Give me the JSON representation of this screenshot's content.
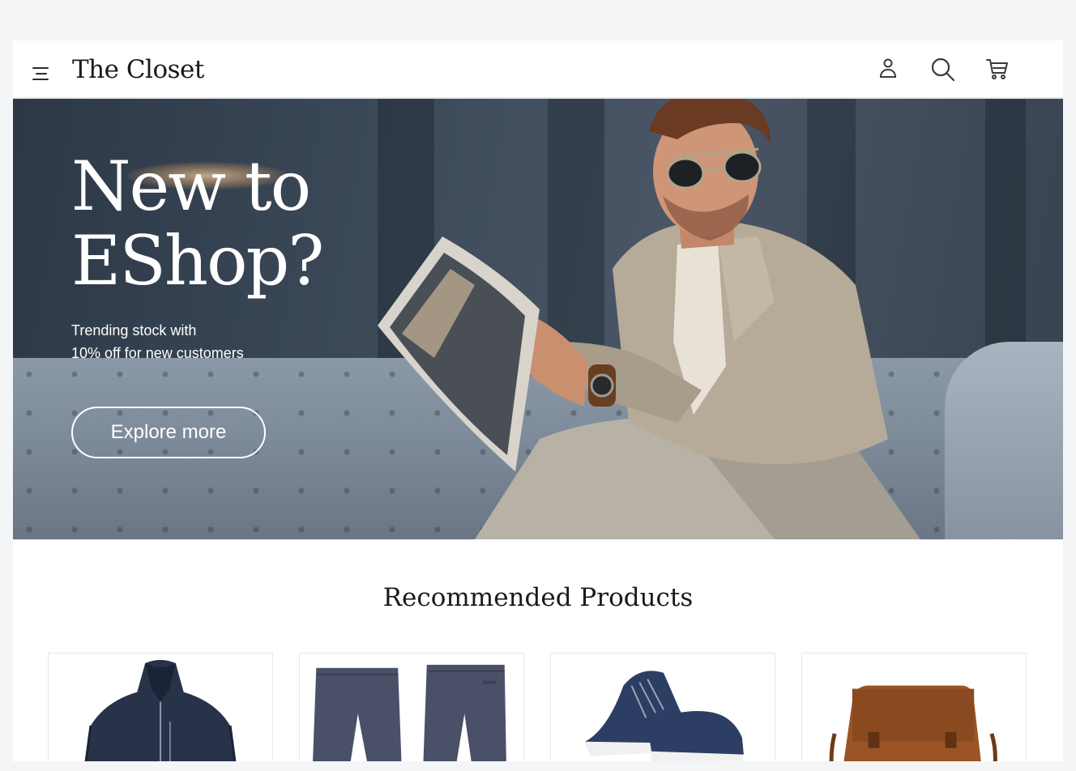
{
  "header": {
    "brand": "The Closet",
    "icons": [
      "menu-icon",
      "user-icon",
      "search-icon",
      "cart-icon"
    ]
  },
  "hero": {
    "title_line1": "New to",
    "title_line2": "EShop?",
    "subtitle_line1": "Trending stock with",
    "subtitle_line2": "10% off for new customers",
    "cta_label": "Explore more"
  },
  "products": {
    "title": "Recommended Products",
    "items": [
      {
        "kind": "jacket",
        "color": "#28334a"
      },
      {
        "kind": "trousers",
        "color": "#4a5068"
      },
      {
        "kind": "sneakers",
        "color": "#2c3e63"
      },
      {
        "kind": "bag",
        "color": "#9a5426"
      }
    ]
  },
  "colors": {
    "text_dark": "#1a1a1a",
    "hero_text": "#ffffff",
    "page_bg": "#f4f5f7"
  }
}
